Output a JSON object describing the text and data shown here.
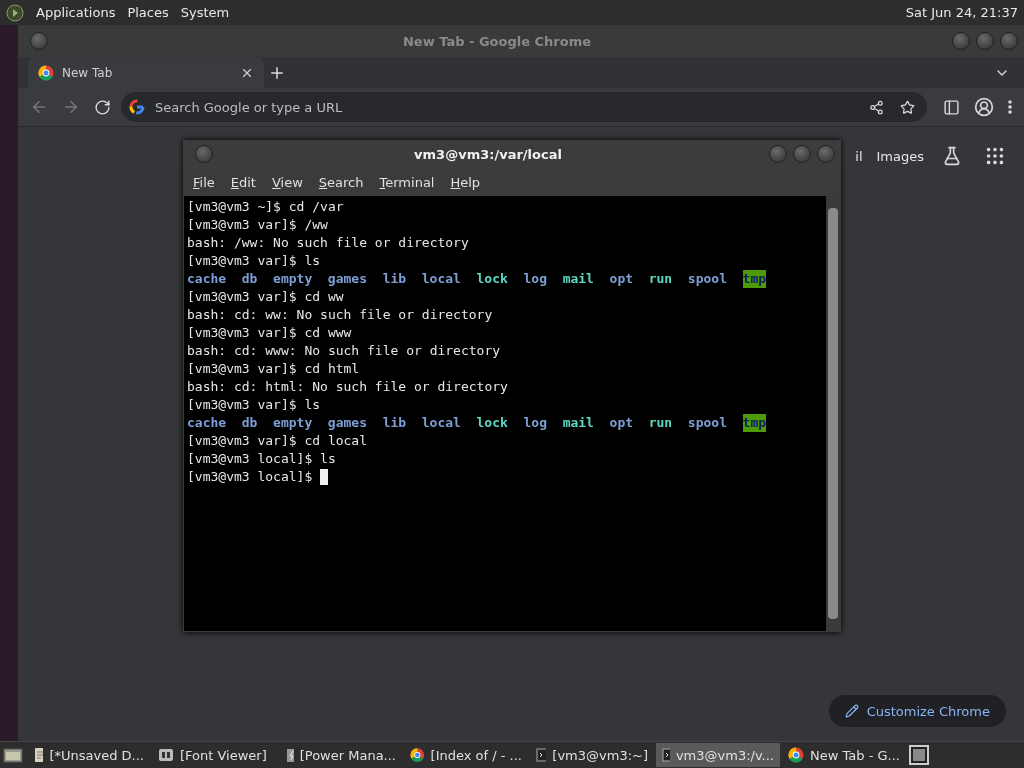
{
  "top_panel": {
    "menus": [
      "Applications",
      "Places",
      "System"
    ],
    "clock": "Sat Jun 24, 21:37"
  },
  "browser": {
    "title": "New Tab - Google Chrome",
    "tabs": [
      {
        "label": "New Tab",
        "selected": true
      }
    ],
    "omnibox": {
      "placeholder": "Search Google or type a URL"
    },
    "links": [
      "il",
      "Images"
    ],
    "customize_button": "Customize Chrome"
  },
  "terminal": {
    "title": "vm3@vm3:/var/local",
    "menus": [
      "File",
      "Edit",
      "View",
      "Search",
      "Terminal",
      "Help"
    ],
    "lines": [
      {
        "kind": "text",
        "text": "[vm3@vm3 ~]$ cd /var"
      },
      {
        "kind": "text",
        "text": "[vm3@vm3 var]$ /ww"
      },
      {
        "kind": "text",
        "text": "bash: /ww: No such file or directory"
      },
      {
        "kind": "text",
        "text": "[vm3@vm3 var]$ ls"
      },
      {
        "kind": "ls",
        "entries": [
          {
            "name": "cache",
            "color": "#7e9fd6",
            "highlighted": false
          },
          {
            "name": "db",
            "color": "#7e9fd6",
            "highlighted": false
          },
          {
            "name": "empty",
            "color": "#7e9fd6",
            "highlighted": false
          },
          {
            "name": "games",
            "color": "#7e9fd6",
            "highlighted": false
          },
          {
            "name": "lib",
            "color": "#7e9fd6",
            "highlighted": false
          },
          {
            "name": "local",
            "color": "#7e9fd6",
            "highlighted": false
          },
          {
            "name": "lock",
            "color": "#5ed6c4",
            "highlighted": false
          },
          {
            "name": "log",
            "color": "#7e9fd6",
            "highlighted": false
          },
          {
            "name": "mail",
            "color": "#5ed6c4",
            "highlighted": false
          },
          {
            "name": "opt",
            "color": "#7e9fd6",
            "highlighted": false
          },
          {
            "name": "run",
            "color": "#5ed6c4",
            "highlighted": false
          },
          {
            "name": "spool",
            "color": "#7e9fd6",
            "highlighted": false
          },
          {
            "name": "tmp",
            "color": "#4e9a06",
            "highlighted": true
          }
        ]
      },
      {
        "kind": "text",
        "text": "[vm3@vm3 var]$ cd ww"
      },
      {
        "kind": "text",
        "text": "bash: cd: ww: No such file or directory"
      },
      {
        "kind": "text",
        "text": "[vm3@vm3 var]$ cd www"
      },
      {
        "kind": "text",
        "text": "bash: cd: www: No such file or directory"
      },
      {
        "kind": "text",
        "text": "[vm3@vm3 var]$ cd html"
      },
      {
        "kind": "text",
        "text": "bash: cd: html: No such file or directory"
      },
      {
        "kind": "text",
        "text": "[vm3@vm3 var]$ ls"
      },
      {
        "kind": "ls",
        "entries": [
          {
            "name": "cache",
            "color": "#7e9fd6",
            "highlighted": false
          },
          {
            "name": "db",
            "color": "#7e9fd6",
            "highlighted": false
          },
          {
            "name": "empty",
            "color": "#7e9fd6",
            "highlighted": false
          },
          {
            "name": "games",
            "color": "#7e9fd6",
            "highlighted": false
          },
          {
            "name": "lib",
            "color": "#7e9fd6",
            "highlighted": false
          },
          {
            "name": "local",
            "color": "#7e9fd6",
            "highlighted": false
          },
          {
            "name": "lock",
            "color": "#5ed6c4",
            "highlighted": false
          },
          {
            "name": "log",
            "color": "#7e9fd6",
            "highlighted": false
          },
          {
            "name": "mail",
            "color": "#5ed6c4",
            "highlighted": false
          },
          {
            "name": "opt",
            "color": "#7e9fd6",
            "highlighted": false
          },
          {
            "name": "run",
            "color": "#5ed6c4",
            "highlighted": false
          },
          {
            "name": "spool",
            "color": "#7e9fd6",
            "highlighted": false
          },
          {
            "name": "tmp",
            "color": "#4e9a06",
            "highlighted": true
          }
        ]
      },
      {
        "kind": "text",
        "text": "[vm3@vm3 var]$ cd local"
      },
      {
        "kind": "text",
        "text": "[vm3@vm3 local]$ ls"
      },
      {
        "kind": "prompt",
        "text": "[vm3@vm3 local]$ "
      }
    ]
  },
  "taskbar": {
    "items": [
      {
        "kind": "document",
        "label": "[*Unsaved D...",
        "selected": false
      },
      {
        "kind": "font",
        "label": "[Font Viewer]",
        "selected": false
      },
      {
        "kind": "power",
        "label": "[Power Mana...",
        "selected": false
      },
      {
        "kind": "chrome",
        "label": "[Index of / - ...",
        "selected": false
      },
      {
        "kind": "terminal",
        "label": "[vm3@vm3:~]",
        "selected": false
      },
      {
        "kind": "terminal",
        "label": "vm3@vm3:/v...",
        "selected": true
      },
      {
        "kind": "chrome",
        "label": "New Tab - G...",
        "selected": false
      }
    ]
  }
}
